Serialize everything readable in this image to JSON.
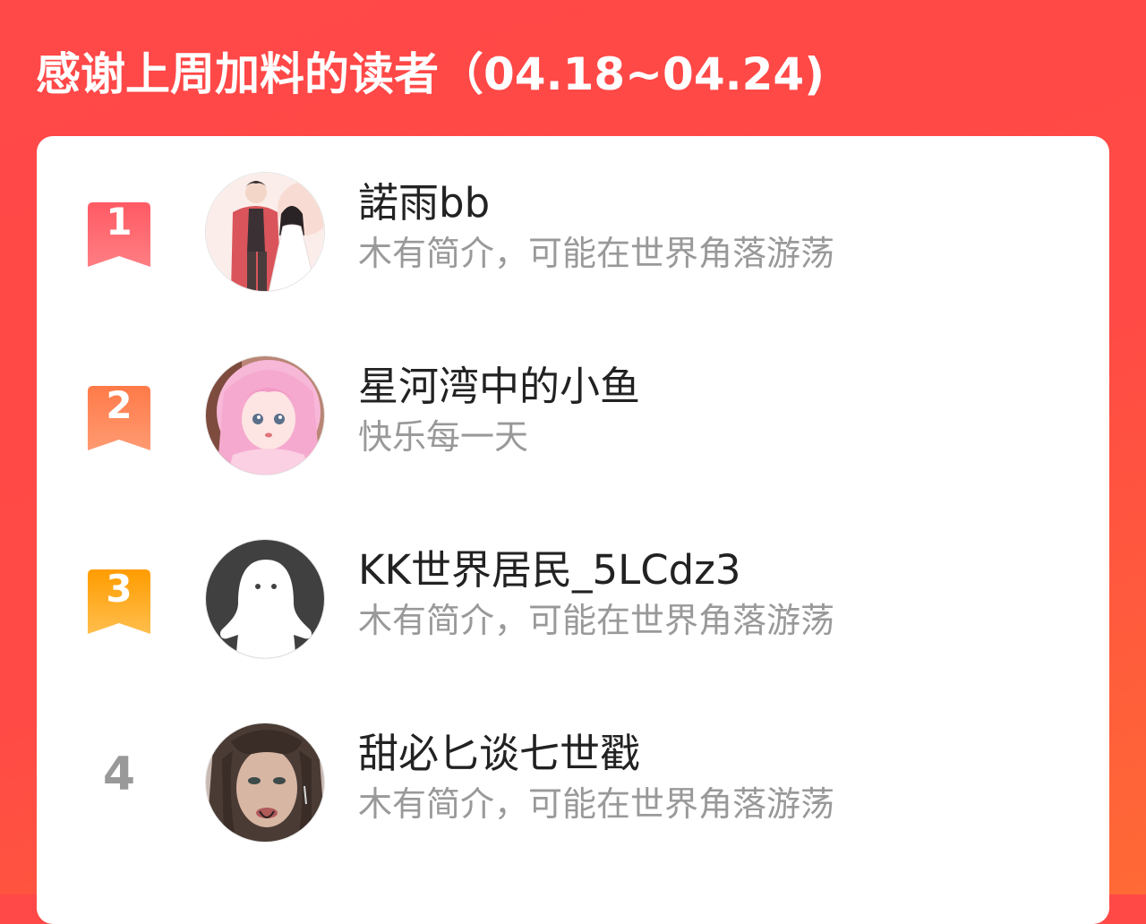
{
  "header": {
    "title": "感谢上周加料的读者（04.18~04.24)"
  },
  "colors": {
    "background": "#ff4848",
    "rank1": "#ff5a5f",
    "rank2": "#ff7e4f",
    "rank3": "#ffa21c",
    "name_text": "#222222",
    "intro_text": "#999999"
  },
  "readers": [
    {
      "rank": "1",
      "name": "諾雨bb",
      "intro": "木有简介，可能在世界角落游荡",
      "avatar_icon": "couple-avatar-icon"
    },
    {
      "rank": "2",
      "name": "星河湾中的小鱼",
      "intro": "快乐每一天",
      "avatar_icon": "pink-hair-girl-avatar-icon"
    },
    {
      "rank": "3",
      "name": "KK世界居民_5LCdz3",
      "intro": "木有简介，可能在世界角落游荡",
      "avatar_icon": "default-user-avatar-icon"
    },
    {
      "rank": "4",
      "name": "甜必匕谈七世戳",
      "intro": "木有简介，可能在世界角落游荡",
      "avatar_icon": "girl-portrait-avatar-icon"
    }
  ]
}
